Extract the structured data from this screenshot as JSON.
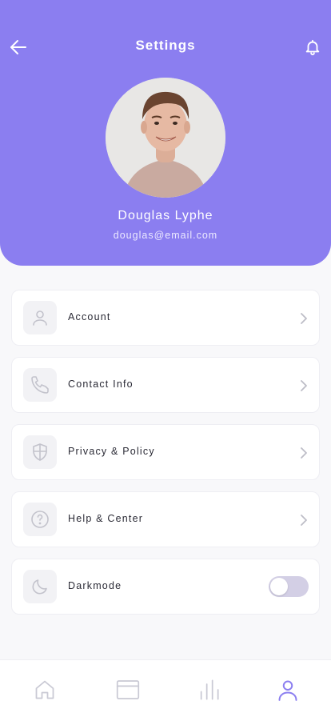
{
  "header": {
    "title": "Settings",
    "background": "#8b7ef0",
    "back_icon": "arrow-left-icon",
    "bell_icon": "bell-icon"
  },
  "profile": {
    "name": "Douglas Lyphe",
    "email": "douglas@email.com"
  },
  "menu": {
    "items": [
      {
        "label": "Account",
        "icon": "user-icon"
      },
      {
        "label": "Contact Info",
        "icon": "phone-icon"
      },
      {
        "label": "Privacy & Policy",
        "icon": "shield-icon"
      },
      {
        "label": "Help & Center",
        "icon": "help-icon"
      },
      {
        "label": "Darkmode",
        "icon": "moon-icon",
        "toggle": false
      }
    ]
  },
  "tabbar": {
    "tabs": [
      {
        "icon": "home-icon",
        "active": false
      },
      {
        "icon": "card-icon",
        "active": false
      },
      {
        "icon": "stats-icon",
        "active": false
      },
      {
        "icon": "profile-icon",
        "active": true
      }
    ],
    "active_color": "#8b7ef0",
    "inactive_color": "#c9c9d4"
  }
}
